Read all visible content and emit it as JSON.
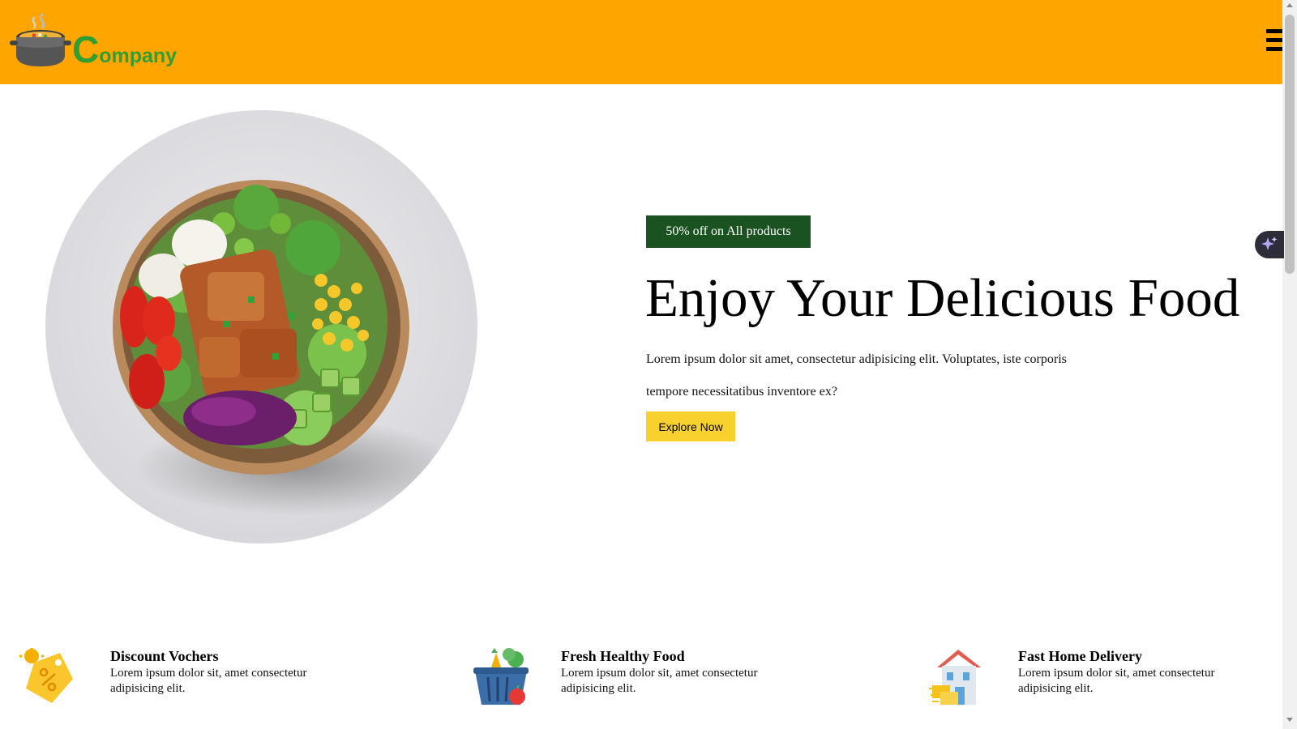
{
  "header": {
    "logo_letter": "C",
    "logo_rest": "ompany",
    "menu_icon": "hamburger-menu-icon",
    "background": "#FFA500",
    "logo_color": "#2f9e33"
  },
  "hero": {
    "promo": "50% off on All products",
    "title": "Enjoy Your Delicious Food",
    "description": "Lorem ipsum dolor sit amet, consectetur adipisicing elit. Voluptates, iste corporis tempore necessitatibus inventore ex?",
    "cta_label": "Explore Now",
    "promo_color": "#1a5321",
    "cta_color": "#F8D12F"
  },
  "features": [
    {
      "title": "Discount Vochers",
      "description": "Lorem ipsum dolor sit, amet consectetur adipisicing elit.",
      "icon": "discount-tag-icon"
    },
    {
      "title": "Fresh Healthy Food",
      "description": "Lorem ipsum dolor sit, amet consectetur adipisicing elit.",
      "icon": "grocery-basket-icon"
    },
    {
      "title": "Fast Home Delivery",
      "description": "Lorem ipsum dolor sit, amet consectetur adipisicing elit.",
      "icon": "delivery-house-icon"
    }
  ],
  "floating": {
    "icon": "sparkle-icon"
  }
}
